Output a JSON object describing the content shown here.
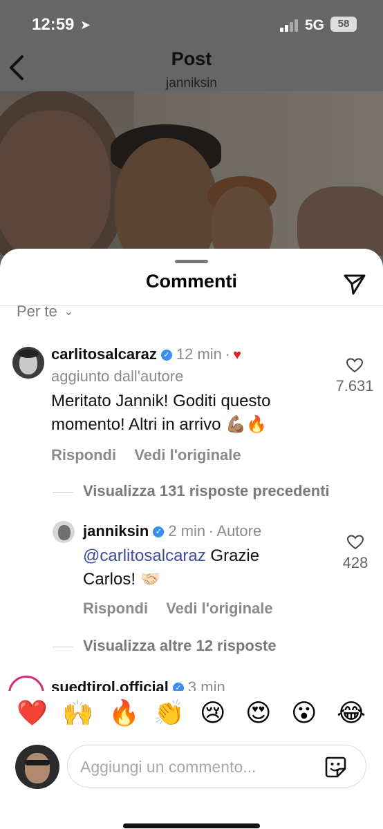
{
  "status_bar": {
    "time": "12:59",
    "network": "5G",
    "battery": "58"
  },
  "nav": {
    "title": "Post",
    "subtitle": "janniksin"
  },
  "sheet": {
    "title": "Commenti",
    "filter_label": "Per te"
  },
  "comments": [
    {
      "username": "carlitosalcaraz",
      "time": "12 min",
      "dot": "·",
      "author_note": "aggiunto dall'autore",
      "text": "Meritato Jannik! Goditi questo momento! Altri in arrivo 💪🏽🔥",
      "likes": "7.631",
      "reply_label": "Rispondi",
      "original_label": "Vedi l'originale",
      "view_replies": "Visualizza 131 risposte precedenti"
    },
    {
      "username": "janniksin",
      "time": "2 min",
      "dot": "·",
      "role": "Autore",
      "mention": "@carlitosalcaraz",
      "text": " Grazie Carlos! 🤝🏻",
      "likes": "428",
      "reply_label": "Rispondi",
      "original_label": "Vedi l'originale",
      "view_replies": "Visualizza altre 12 risposte"
    },
    {
      "username": "suedtirol.official",
      "time": "3 min"
    }
  ],
  "emoji_bar": [
    "❤️",
    "🙌",
    "🔥",
    "👏",
    "😢",
    "😍",
    "😮",
    "😂"
  ],
  "compose": {
    "placeholder": "Aggiungi un commento..."
  },
  "colors": {
    "verified": "#3a8ef0",
    "mention": "#3b4aa0",
    "liked_heart": "#e0202a"
  }
}
